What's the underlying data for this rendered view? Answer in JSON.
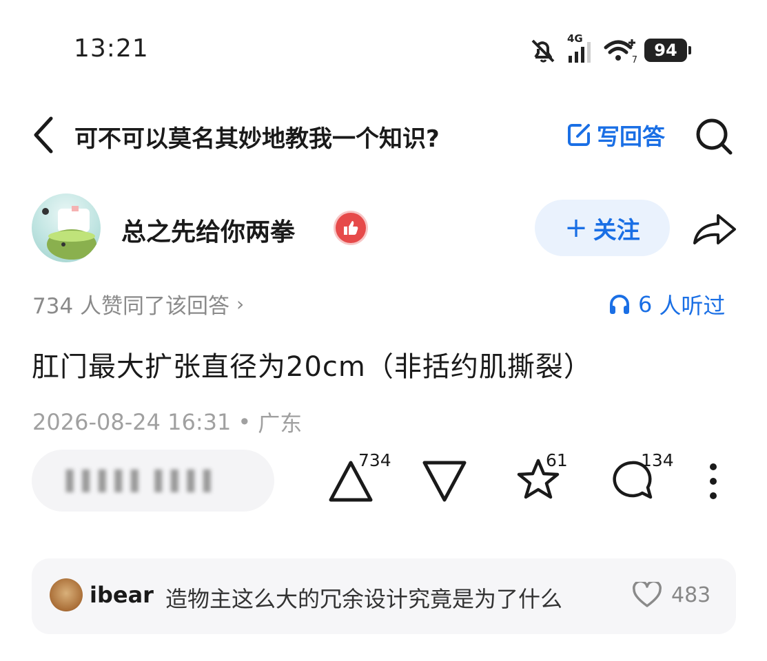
{
  "status_bar": {
    "time": "13:21",
    "network_label": "4G",
    "wifi_badge": "7",
    "battery": "94"
  },
  "header": {
    "question_title": "可不可以莫名其妙地教我一个知识?",
    "write_answer_label": "写回答"
  },
  "author": {
    "name": "总之先给你两拳",
    "follow_label": "关注"
  },
  "meta": {
    "agree_text": "734 人赞同了该回答",
    "listened_count": "6",
    "listened_suffix": "人听过"
  },
  "answer": {
    "text": "肛门最大扩张直径为20cm（非括约肌撕裂）",
    "date": "2026-08-24 16:31",
    "location": "广东"
  },
  "actions": {
    "comment_input_placeholder": "▌▌▌▌▌  ▌▌▌▌",
    "upvote_count": "734",
    "favorite_count": "61",
    "comment_count": "134"
  },
  "comment_preview": {
    "user": "ibear",
    "text": "造物主这么大的冗余设计究竟是为了什么",
    "likes": "483"
  },
  "colors": {
    "accent": "#1a6fe5",
    "follow_bg": "#eaf2fd",
    "badge": "#e64a4a"
  }
}
